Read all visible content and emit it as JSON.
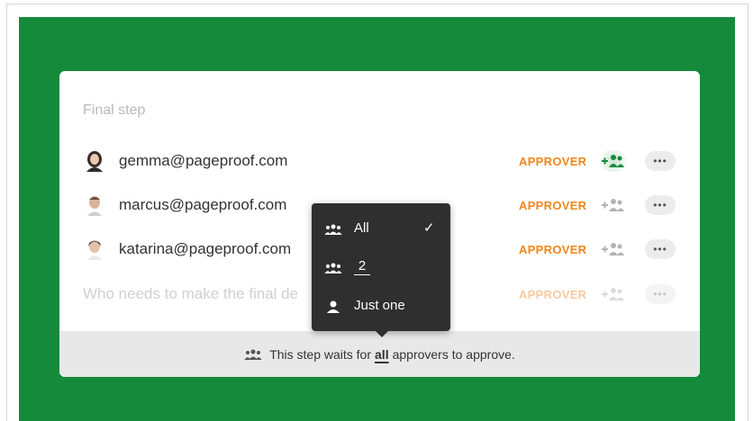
{
  "step": {
    "title": "Final step"
  },
  "approvers": [
    {
      "email": "gemma@pageproof.com",
      "role": "APPROVER",
      "avatar_icon": "person-photo-icon",
      "add_active": true
    },
    {
      "email": "marcus@pageproof.com",
      "role": "APPROVER",
      "avatar_icon": "person-photo-icon",
      "add_active": false
    },
    {
      "email": "katarina@pageproof.com",
      "role": "APPROVER",
      "avatar_icon": "person-photo-icon",
      "add_active": false
    }
  ],
  "new_row": {
    "placeholder": "Who needs to make the final de",
    "role": "APPROVER"
  },
  "more_label": "•••",
  "dropdown": {
    "options": [
      {
        "label": "All",
        "icon": "group-icon",
        "selected": true
      },
      {
        "label": "2",
        "icon": "group-icon",
        "selected": false
      },
      {
        "label": "Just one",
        "icon": "person-icon",
        "selected": false
      }
    ],
    "check": "✓"
  },
  "footer": {
    "prefix": "This step waits for",
    "emphasis": "all",
    "suffix": "approvers to approve."
  },
  "colors": {
    "brand_green": "#168a3b",
    "role_orange": "#f0861d",
    "menu_bg": "#2f2f2f"
  }
}
